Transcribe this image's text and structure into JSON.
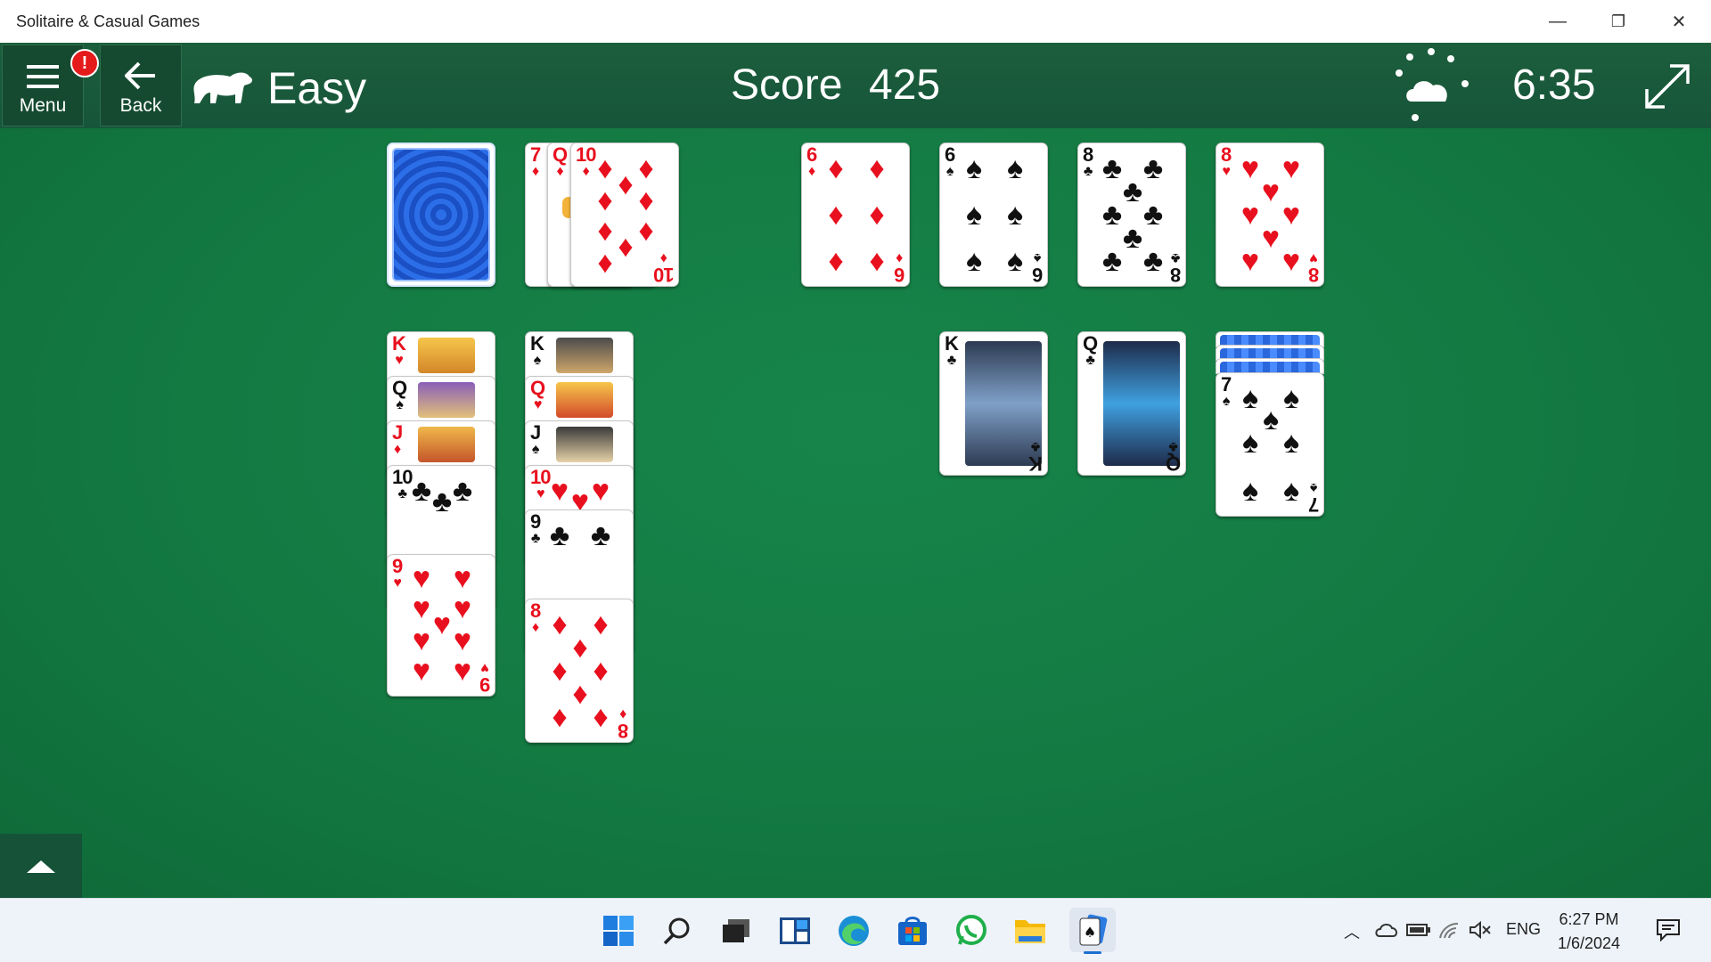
{
  "window": {
    "title": "Solitaire & Casual Games",
    "minimize": "—",
    "restore": "❐",
    "close": "✕"
  },
  "header": {
    "menu_label": "Menu",
    "menu_badge": "!",
    "back_label": "Back",
    "difficulty": "Easy",
    "score_label": "Score",
    "score_value": "425",
    "timer": "6:35"
  },
  "colors": {
    "felt": "#137a42",
    "header": "#17553a",
    "red_suit": "#e8101e",
    "black_suit": "#111111",
    "badge": "#e51a1a"
  },
  "icons": [
    "hamburger-icon",
    "back-arrow-icon",
    "polar-bear-icon",
    "weather-icon",
    "expand-icon",
    "chevron-up-icon"
  ],
  "cards": {
    "waste": [
      {
        "rank": "7",
        "suit": "♦"
      },
      {
        "rank": "Q",
        "suit": "♦"
      },
      {
        "rank": "10",
        "suit": "♦"
      }
    ],
    "foundations": [
      {
        "rank": "6",
        "suit": "♦"
      },
      {
        "rank": "6",
        "suit": "♠"
      },
      {
        "rank": "8",
        "suit": "♣"
      },
      {
        "rank": "8",
        "suit": "♥"
      }
    ],
    "tableau_1": [
      {
        "rank": "K",
        "suit": "♥"
      },
      {
        "rank": "Q",
        "suit": "♠"
      },
      {
        "rank": "J",
        "suit": "♦"
      },
      {
        "rank": "10",
        "suit": "♣"
      },
      {
        "rank": "9",
        "suit": "♥"
      }
    ],
    "tableau_2": [
      {
        "rank": "K",
        "suit": "♠"
      },
      {
        "rank": "Q",
        "suit": "♥"
      },
      {
        "rank": "J",
        "suit": "♠"
      },
      {
        "rank": "10",
        "suit": "♥"
      },
      {
        "rank": "9",
        "suit": "♣"
      },
      {
        "rank": "8",
        "suit": "♦"
      }
    ],
    "tableau_6": [
      {
        "rank": "K",
        "suit": "♣"
      }
    ],
    "tableau_7": [
      {
        "rank": "Q",
        "suit": "♣"
      }
    ],
    "tableau_8": [
      {
        "rank": "7",
        "suit": "♠"
      }
    ]
  },
  "taskbar": {
    "apps": [
      "start-icon",
      "search-icon",
      "task-view-icon",
      "widgets-icon",
      "edge-icon",
      "store-icon",
      "whatsapp-icon",
      "file-explorer-icon",
      "solitaire-icon"
    ],
    "language": "ENG",
    "time": "6:27 PM",
    "date": "1/6/2024"
  }
}
